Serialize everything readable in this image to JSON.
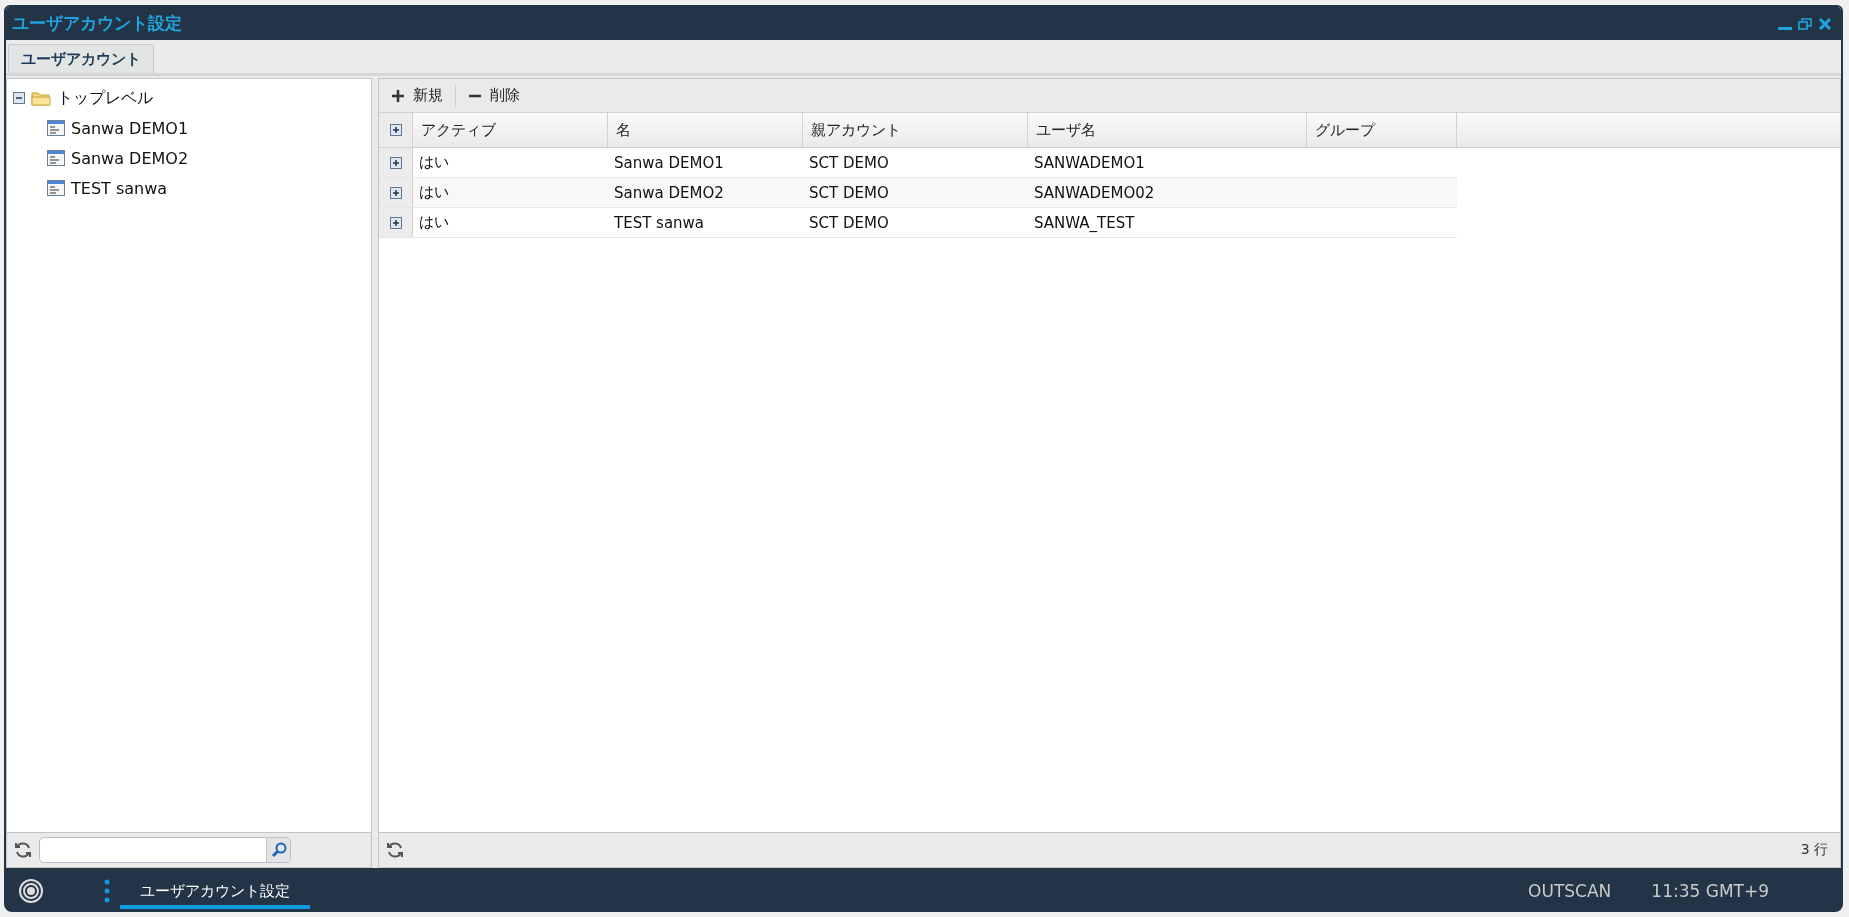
{
  "window": {
    "title": "ユーザアカウント設定"
  },
  "tabs": [
    {
      "label": "ユーザアカウント",
      "selected": true
    }
  ],
  "tree": {
    "label": "トップレベル",
    "expanded": true,
    "children": [
      {
        "label": "Sanwa DEMO1"
      },
      {
        "label": "Sanwa DEMO2"
      },
      {
        "label": "TEST sanwa"
      }
    ]
  },
  "toolbar": [
    {
      "kind": "add",
      "label": "新規"
    },
    {
      "kind": "remove",
      "label": "削除"
    }
  ],
  "table": {
    "columns": [
      "アクティブ",
      "名",
      "親アカウント",
      "ユーザ名",
      "グループ"
    ],
    "rows": [
      {
        "cells": [
          "はい",
          "Sanwa DEMO1",
          "SCT DEMO",
          "SANWADEMO1"
        ]
      },
      {
        "cells": [
          "はい",
          "Sanwa DEMO2",
          "SCT DEMO",
          "SANWADEMO02"
        ]
      },
      {
        "cells": [
          "はい",
          "TEST sanwa",
          "SCT DEMO",
          "SANWA_TEST"
        ]
      }
    ]
  },
  "status": "3 行",
  "taskbar": {
    "tasks": [
      {
        "label": "ユーザアカウント設定",
        "selected": true
      }
    ],
    "mode": "OUTSCAN",
    "clock": "11:35 GMT+9"
  }
}
